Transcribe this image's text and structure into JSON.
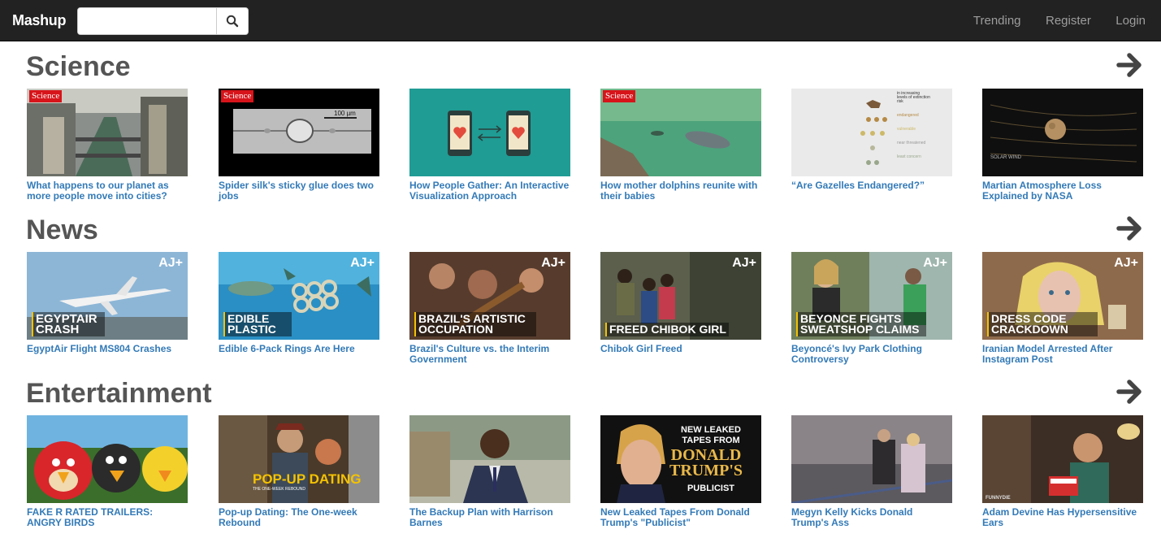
{
  "app": {
    "brand": "Mashup",
    "search_placeholder": "",
    "nav": [
      "Trending",
      "Register",
      "Login"
    ]
  },
  "sections": [
    {
      "title": "Science",
      "items": [
        {
          "caption": "What happens to our planet as more people move into cities?",
          "badge": "Science",
          "overlay": ""
        },
        {
          "caption": "Spider silk's sticky glue does two jobs",
          "badge": "Science",
          "overlay": "",
          "inset_label": "100 µm"
        },
        {
          "caption": "How People Gather: An Interactive Visualization Approach",
          "badge": "",
          "overlay": ""
        },
        {
          "caption": "How mother dolphins reunite with their babies",
          "badge": "Science",
          "overlay": ""
        },
        {
          "caption": "“Are Gazelles Endangered?”",
          "badge": "",
          "overlay": "",
          "chart_lines": [
            "in increasing levels of extinction risk",
            "endangered",
            "vulnerable",
            "near threatened",
            "least concern"
          ]
        },
        {
          "caption": "Martian Atmosphere Loss Explained by NASA",
          "badge": "",
          "overlay": "",
          "inset_label": "SOLAR WIND"
        }
      ]
    },
    {
      "title": "News",
      "items": [
        {
          "caption": "EgyptAir Flight MS804 Crashes",
          "overlay": "EGYPTAIR CRASH",
          "logo": "AJ+"
        },
        {
          "caption": "Edible 6-Pack Rings Are Here",
          "overlay": "EDIBLE PLASTIC",
          "logo": "AJ+"
        },
        {
          "caption": "Brazil's Culture vs. the Interim Government",
          "overlay": "BRAZIL'S ARTISTIC OCCUPATION",
          "logo": "AJ+"
        },
        {
          "caption": "Chibok Girl Freed",
          "overlay": "FREED CHIBOK GIRL",
          "logo": "AJ+"
        },
        {
          "caption": "Beyoncé's Ivy Park Clothing Controversy",
          "overlay": "BEYONCE FIGHTS SWEATSHOP CLAIMS",
          "logo": "AJ+"
        },
        {
          "caption": "Iranian Model Arrested After Instagram Post",
          "overlay": "DRESS CODE CRACKDOWN",
          "logo": "AJ+"
        }
      ]
    },
    {
      "title": "Entertainment",
      "items": [
        {
          "caption": "FAKE R RATED TRAILERS: ANGRY BIRDS",
          "overlay": ""
        },
        {
          "caption": "Pop-up Dating: The One-week Rebound",
          "overlay": "POP-UP DATING",
          "sub_overlay": "THE ONE-WEEK REBOUND"
        },
        {
          "caption": "The Backup Plan with Harrison Barnes",
          "overlay": ""
        },
        {
          "caption": "New Leaked Tapes From Donald Trump's \"Publicist\"",
          "overlay": "NEW LEAKED TAPES FROM",
          "big": "DONALD TRUMP'S",
          "sub_overlay": "PUBLICIST"
        },
        {
          "caption": "Megyn Kelly Kicks Donald Trump's Ass",
          "overlay": ""
        },
        {
          "caption": "Adam Devine Has Hypersensitive Ears",
          "overlay": "",
          "logo": "FUNNYDIE"
        }
      ]
    }
  ],
  "colors": {
    "navbar": "#222222",
    "link": "#337ab7",
    "heading": "#555555"
  },
  "icons": {
    "search": "search-icon",
    "arrow": "arrow-right-icon"
  }
}
